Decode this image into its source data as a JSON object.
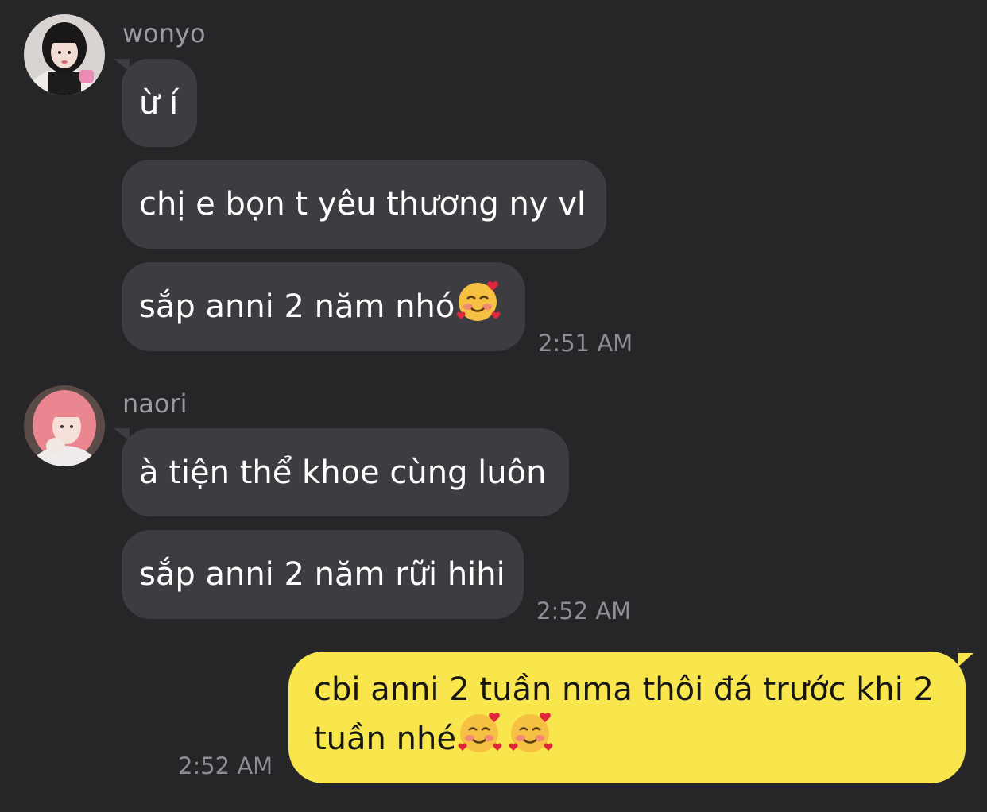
{
  "messages": [
    {
      "sender": "wonyo",
      "avatar": "avatar-wonyo",
      "bubbles": [
        "ừ í",
        "chị e bọn t yêu thương ny vl",
        "sắp anni 2 năm nhó"
      ],
      "time": "2:51 AM"
    },
    {
      "sender": "naori",
      "avatar": "avatar-naori",
      "bubbles": [
        "à tiện thể khoe cùng luôn",
        "sắp anni 2 năm rữi hihi"
      ],
      "time": "2:52 AM"
    }
  ],
  "outgoing": {
    "text": "cbi anni 2 tuần nma thôi đá trước khi 2 tuần nhé",
    "time": "2:52 AM"
  },
  "emoji_icon": "smiling-face-with-hearts-icon",
  "colors": {
    "background": "#262629",
    "incoming_bubble": "#3d3d41",
    "outgoing_bubble": "#f8e64c",
    "sender_text": "#9a9a9f",
    "time_text": "#8d8d92"
  }
}
